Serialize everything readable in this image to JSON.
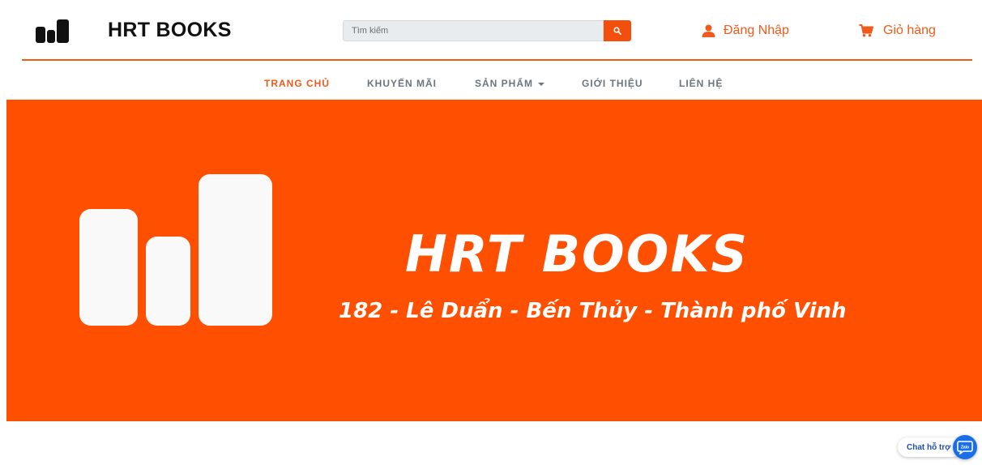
{
  "header": {
    "brand": "HRT BOOKS",
    "search": {
      "placeholder": "Tìm kiếm",
      "value": ""
    },
    "login_label": "Đăng Nhập",
    "cart_label": "Giỏ hàng"
  },
  "nav": {
    "items": [
      {
        "label": "TRANG CHỦ",
        "active": true
      },
      {
        "label": "KHUYẾN MÃI",
        "active": false
      },
      {
        "label": "SẢN PHẨM",
        "active": false,
        "dropdown": true
      },
      {
        "label": "GIỚI THIỆU",
        "active": false
      },
      {
        "label": "LIÊN HỆ",
        "active": false
      }
    ]
  },
  "banner": {
    "title": "HRT BOOKS",
    "address": "182 - Lê Duẩn - Bến Thủy - Thành phố Vinh"
  },
  "chat": {
    "label": "Chat hỗ trợ",
    "icon_text": "Zalo"
  },
  "colors": {
    "accent": "#f05a1a",
    "banner_bg": "#fe5000",
    "nav_text": "#6c757d",
    "chat_blue": "#1a6fe8"
  },
  "icons": {
    "logo": "bar-chart-logo-icon",
    "search": "search-icon",
    "login": "user-icon",
    "cart": "cart-icon",
    "chat": "zalo-chat-icon"
  }
}
